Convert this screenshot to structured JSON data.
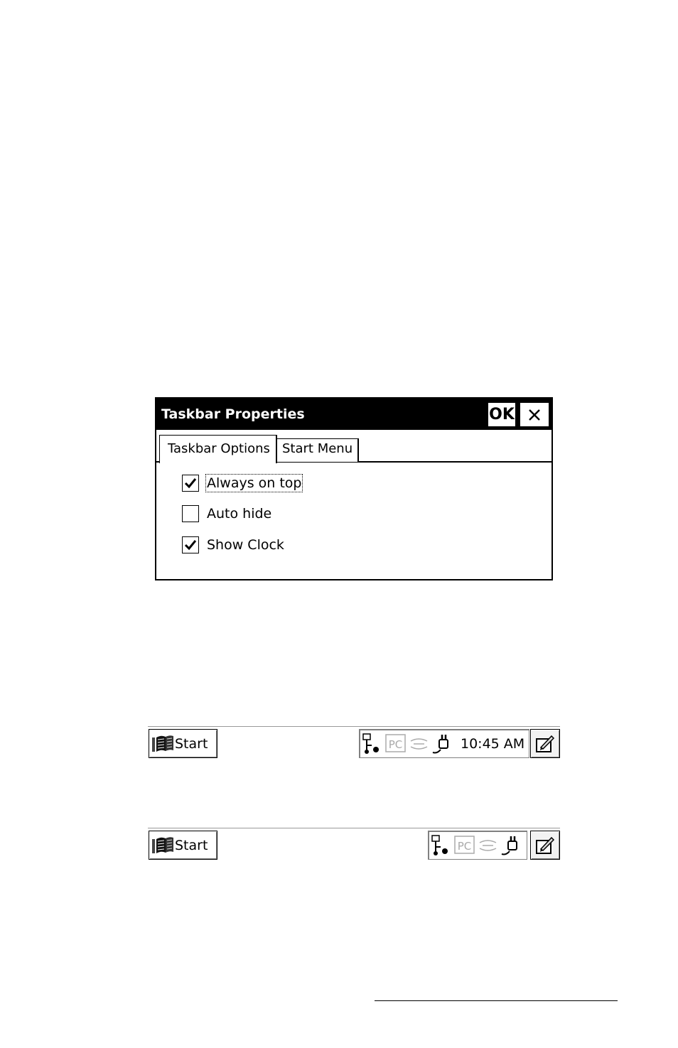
{
  "dialog": {
    "title": "Taskbar Properties",
    "ok_label": "OK",
    "close_icon": "close-icon",
    "tabs": [
      {
        "label": "Taskbar Options",
        "active": true
      },
      {
        "label": "Start Menu",
        "active": false
      }
    ],
    "options": [
      {
        "label": "Always on top",
        "checked": true,
        "focused": true
      },
      {
        "label": "Auto hide",
        "checked": false,
        "focused": false
      },
      {
        "label": "Show Clock",
        "checked": true,
        "focused": false
      }
    ]
  },
  "taskbars": [
    {
      "start_label": "Start",
      "tray_icons": [
        "network-icon",
        "pc-connection-icon",
        "infrared-icon",
        "power-plug-icon"
      ],
      "clock": "10:45 AM",
      "sip_icon": "input-panel-icon"
    },
    {
      "start_label": "Start",
      "tray_icons": [
        "network-icon",
        "pc-connection-icon",
        "infrared-icon",
        "power-plug-icon"
      ],
      "sip_icon": "input-panel-icon"
    }
  ]
}
